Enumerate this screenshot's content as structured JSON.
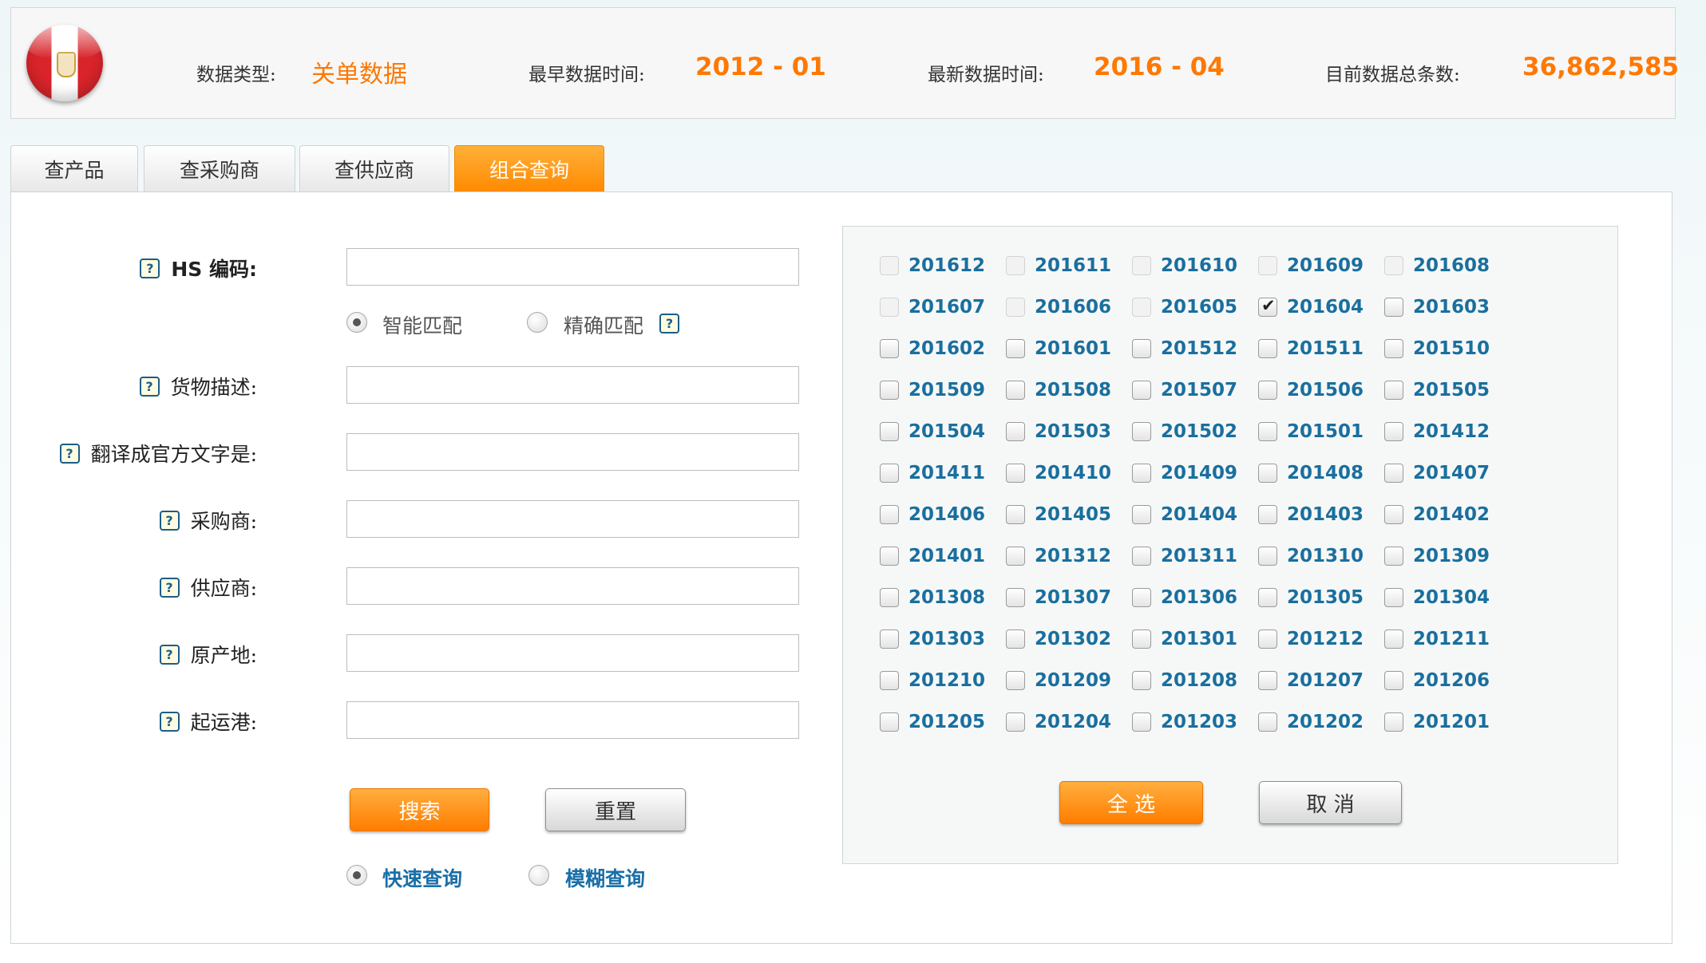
{
  "header": {
    "data_type_label": "数据类型:",
    "data_type_value": "关单数据",
    "earliest_label": "最早数据时间:",
    "earliest_value": "2012 - 01",
    "latest_label": "最新数据时间:",
    "latest_value": "2016 - 04",
    "total_label": "目前数据总条数:",
    "total_value": "36,862,585",
    "flag_icon": "peru-flag-icon"
  },
  "tabs": [
    {
      "label": "查产品"
    },
    {
      "label": "查采购商"
    },
    {
      "label": "查供应商"
    },
    {
      "label": "组合查询",
      "active": true
    }
  ],
  "form": {
    "hs_label": "HS 编码:",
    "match_smart": "智能匹配",
    "match_exact": "精确匹配",
    "goods_label": "货物描述:",
    "translate_label": "翻译成官方文字是:",
    "buyer_label": "采购商:",
    "supplier_label": "供应商:",
    "origin_label": "原产地:",
    "port_label": "起运港:",
    "help_glyph": "?",
    "search_button": "搜索",
    "reset_button": "重置",
    "quick_query": "快速查询",
    "fuzzy_query": "模糊查询"
  },
  "months": {
    "items": [
      "201612",
      "201611",
      "201610",
      "201609",
      "201608",
      "201607",
      "201606",
      "201605",
      "201604",
      "201603",
      "201602",
      "201601",
      "201512",
      "201511",
      "201510",
      "201509",
      "201508",
      "201507",
      "201506",
      "201505",
      "201504",
      "201503",
      "201502",
      "201501",
      "201412",
      "201411",
      "201410",
      "201409",
      "201408",
      "201407",
      "201406",
      "201405",
      "201404",
      "201403",
      "201402",
      "201401",
      "201312",
      "201311",
      "201310",
      "201309",
      "201308",
      "201307",
      "201306",
      "201305",
      "201304",
      "201303",
      "201302",
      "201301",
      "201212",
      "201211",
      "201210",
      "201209",
      "201208",
      "201207",
      "201206",
      "201205",
      "201204",
      "201203",
      "201202",
      "201201"
    ],
    "checked": [
      "201604"
    ],
    "unavailable": [
      "201612",
      "201611",
      "201610",
      "201609",
      "201608",
      "201607",
      "201606",
      "201605"
    ],
    "select_all_button": "全 选",
    "cancel_button": "取 消"
  }
}
